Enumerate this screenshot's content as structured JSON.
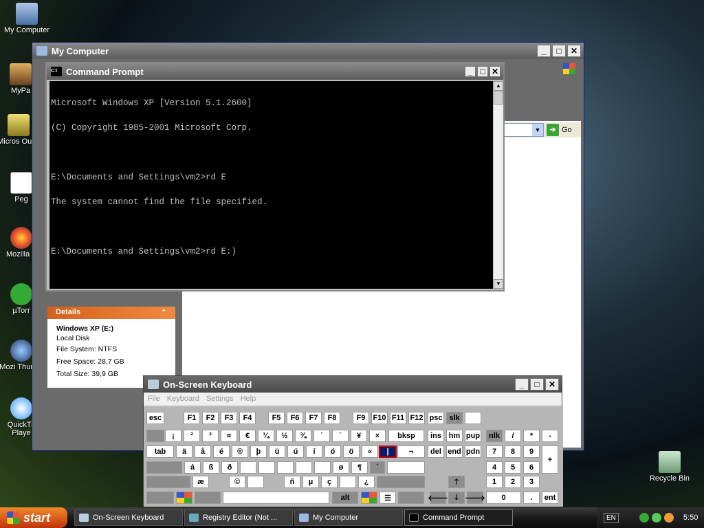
{
  "desktop": {
    "icons": [
      {
        "label": "My Computer"
      },
      {
        "label": "MyPa"
      },
      {
        "label": "Micros Outlo"
      },
      {
        "label": "Peg"
      },
      {
        "label": "Mozilla F"
      },
      {
        "label": "µTorr"
      },
      {
        "label": "Mozi Thunde"
      },
      {
        "label": "QuickTir Playe"
      },
      {
        "label": "Recycle Bin"
      }
    ]
  },
  "my_computer": {
    "title": "My Computer",
    "address_go": "Go",
    "details": {
      "header": "Details",
      "name": "Windows XP (E:)",
      "type": "Local Disk",
      "file_system": "File System: NTFS",
      "free_space": "Free Space: 28,7 GB",
      "total_size": "Total Size: 39,9 GB"
    }
  },
  "command_prompt": {
    "title": "Command Prompt",
    "icon_text": "C:\\",
    "lines": [
      "Microsoft Windows XP [Version 5.1.2600]",
      "(C) Copyright 1985-2001 Microsoft Corp.",
      "",
      "E:\\Documents and Settings\\vm2>rd E",
      "The system cannot find the file specified.",
      "",
      "E:\\Documents and Settings\\vm2>rd E:)"
    ]
  },
  "osk": {
    "title": "On-Screen Keyboard",
    "menu": [
      "File",
      "Keyboard",
      "Settings",
      "Help"
    ],
    "row1": [
      "esc",
      "F1",
      "F2",
      "F3",
      "F4",
      "F5",
      "F6",
      "F7",
      "F8",
      "F9",
      "F10",
      "F11",
      "F12",
      "psc",
      "slk",
      ""
    ],
    "row2": [
      "",
      "¡",
      "²",
      "³",
      "¤",
      "€",
      "¼",
      "½",
      "¾",
      "´",
      "´",
      "¥",
      "×",
      "bksp",
      "ins",
      "hm",
      "pup",
      "nlk",
      "/",
      "*",
      "-"
    ],
    "row3": [
      "tab",
      "ä",
      "å",
      "é",
      "®",
      "þ",
      "ü",
      "ú",
      "í",
      "ó",
      "ö",
      "«",
      "|",
      "¬",
      "del",
      "end",
      "pdn",
      "7",
      "8",
      "9",
      "+"
    ],
    "row4": [
      "",
      "á",
      "ß",
      "ð",
      "",
      "",
      "",
      "",
      "",
      "ø",
      "¶",
      "´",
      "",
      "4",
      "5",
      "6"
    ],
    "row5": [
      "",
      "æ",
      "©",
      "",
      "ñ",
      "µ",
      "ç",
      "",
      "¿",
      "",
      "",
      "1",
      "2",
      "3"
    ],
    "row6": [
      "",
      "",
      "",
      "",
      "alt",
      "",
      "",
      "",
      "0",
      ".",
      "ent"
    ]
  },
  "taskbar": {
    "start": "start",
    "tasks": [
      "On-Screen Keyboard",
      "Registry Editor (Not ...",
      "My Computer",
      "Command Prompt"
    ],
    "lang": "EN",
    "clock": "5:50"
  },
  "colors": {
    "title_active": "#0a5ad2",
    "details_header": "#d5611b",
    "console_bg": "#000000",
    "console_fg": "#c0c0c0"
  }
}
